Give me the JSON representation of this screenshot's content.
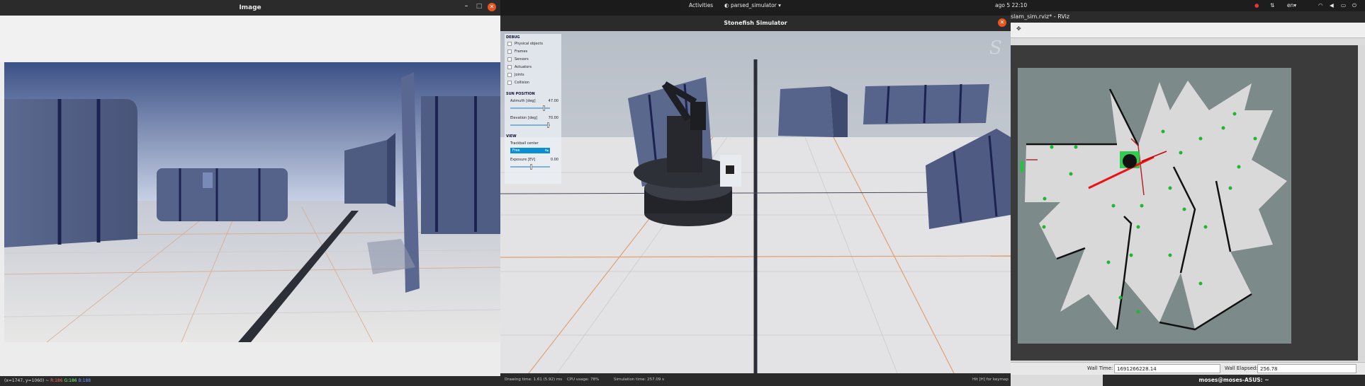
{
  "image_window": {
    "title": "Image",
    "status": {
      "coords": "(x=1747, y=1060) ~",
      "r": "R:186",
      "g": "G:186",
      "b": "B:188"
    }
  },
  "top_panel": {
    "activities": "Activities",
    "app_menu": "parsed_simulator ▾",
    "clock": "ago 5 22:10",
    "lang": "en▾"
  },
  "stonefish": {
    "title": "Stonefish Simulator",
    "debug": {
      "section_debug": "DEBUG",
      "items": [
        "Physical objects",
        "Frames",
        "Sensors",
        "Actuators",
        "Joints",
        "Collision"
      ],
      "section_sun": "SUN POSITION",
      "azimuth_label": "Azimuth [deg]",
      "azimuth_value": "47.00",
      "elevation_label": "Elevation [deg]",
      "elevation_value": "70.00",
      "section_view": "VIEW",
      "trackball_label": "Trackball center",
      "trackball_value": "Free",
      "exposure_label": "Exposure [EV]",
      "exposure_value": "0.00"
    },
    "status": {
      "drawing": "Drawing time: 1.61 (5.92) ms",
      "cpu": "CPU usage: 78%",
      "sim_time": "Simulation time: 257.09 s",
      "hint": "Hit [H] for keymap"
    }
  },
  "rviz": {
    "title": "slam_sim.rviz* - RViz",
    "wall_time_label": "Wall Time:",
    "wall_time_value": "1691266228.14",
    "wall_elapsed_label": "Wall Elapsed:",
    "wall_elapsed_value": "256.78"
  },
  "terminal": {
    "title": "moses@moses-ASUS: ~"
  },
  "colors": {
    "accent": "#e95420",
    "map_free": "#d9d9d9",
    "map_unknown": "#7d8a8a",
    "landmark": "#1db82c"
  }
}
